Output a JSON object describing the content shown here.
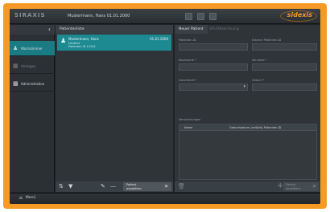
{
  "topbar": {
    "logo": "SIRAXIS",
    "patient": "Mustermann, Hans  01.01.2000",
    "brand": "sidexis",
    "icons": [
      "monitor-icon",
      "keyboard-icon",
      "user-icon"
    ]
  },
  "leftnav": {
    "collapse": "‹",
    "items": [
      {
        "label": "Wartezimmer",
        "icon": "patient-icon",
        "active": true
      },
      {
        "label": "Anzeigen",
        "icon": "display-icon",
        "active": false
      },
      {
        "label": "Administration",
        "icon": "admin-icon",
        "active": false
      }
    ]
  },
  "patient_list": {
    "title": "Patientenliste",
    "rows": [
      {
        "name": "Mustermann, Hans",
        "date": "01.01.2000",
        "sub1": "Heidelst",
        "sub2": "Patienten ID 12345"
      }
    ],
    "toolbar": {
      "select_label": "Patient auswählen"
    }
  },
  "form": {
    "tabs": {
      "active": "Neuer Patient",
      "inactive": "VD-/Abrechnung"
    },
    "fields": {
      "patient_id": {
        "label": "Patienten-ID",
        "value": ""
      },
      "external_id": {
        "label": "Externe Patienten-ID",
        "value": ""
      },
      "lastname": {
        "label": "Nachname *",
        "value": ""
      },
      "firstname": {
        "label": "Vorname *",
        "value": ""
      },
      "gender": {
        "label": "Geschlecht *",
        "value": ""
      },
      "birthdate": {
        "label": "Geburt *",
        "value": ""
      }
    },
    "insurance": {
      "title": "Versicherungen",
      "col_name": "Name",
      "col_birth": "Geburtsdatum (seit/bis) Patienten-ID"
    },
    "toolbar": {
      "select_label": "Patient auswählen"
    }
  },
  "bottombar": {
    "menu_label": "Menü"
  }
}
